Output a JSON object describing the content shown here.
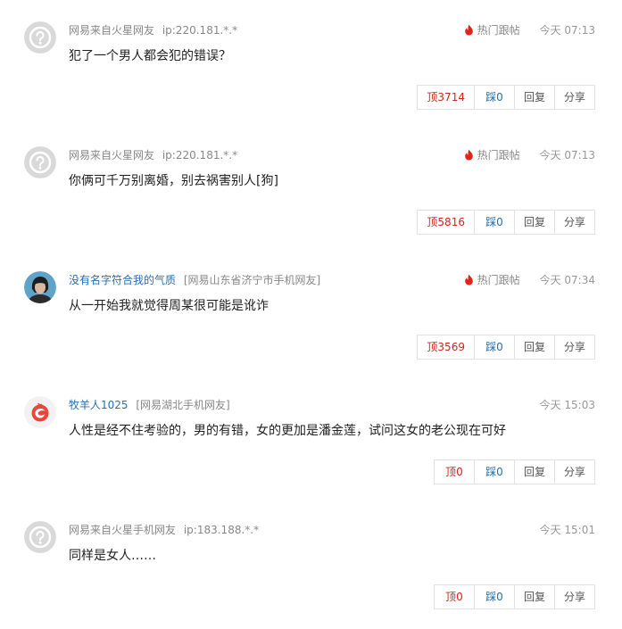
{
  "labels": {
    "hot": "热门跟帖",
    "reply": "回复",
    "share": "分享"
  },
  "colors": {
    "up": "#d4241a",
    "down": "#2a6fb0",
    "hot_flame": "#e2231a"
  },
  "comments": [
    {
      "avatar": "default-avatar-icon",
      "user": "网易来自火星网友",
      "location": "ip:220.181.*.*",
      "hot": true,
      "time": "今天 07:13",
      "text": "犯了一个男人都会犯的错误？",
      "up": "顶3714",
      "down": "踩0"
    },
    {
      "avatar": "default-avatar-icon",
      "user": "网易来自火星网友",
      "location": "ip:220.181.*.*",
      "hot": true,
      "time": "今天 07:13",
      "text": "你俩可千万别离婚，别去祸害别人[狗]",
      "up": "顶5816",
      "down": "踩0"
    },
    {
      "avatar": "photo-avatar",
      "user": "没有名字符合我的气质",
      "location": "[网易山东省济宁市手机网友]",
      "hot": true,
      "time": "今天 07:34",
      "text": "从一开始我就觉得周某很可能是讹诈",
      "up": "顶3569",
      "down": "踩0"
    },
    {
      "avatar": "app-avatar",
      "user": "牧羊人1025",
      "location": "[网易湖北手机网友]",
      "hot": false,
      "time": "今天 15:03",
      "text": "人性是经不住考验的，男的有错，女的更加是潘金莲，试问这女的老公现在可好",
      "up": "顶0",
      "down": "踩0"
    },
    {
      "avatar": "default-avatar-icon",
      "user": "网易来自火星手机网友",
      "location": "ip:183.188.*.*",
      "hot": false,
      "time": "今天 15:01",
      "text": "同样是女人……",
      "up": "顶0",
      "down": "踩0"
    }
  ]
}
